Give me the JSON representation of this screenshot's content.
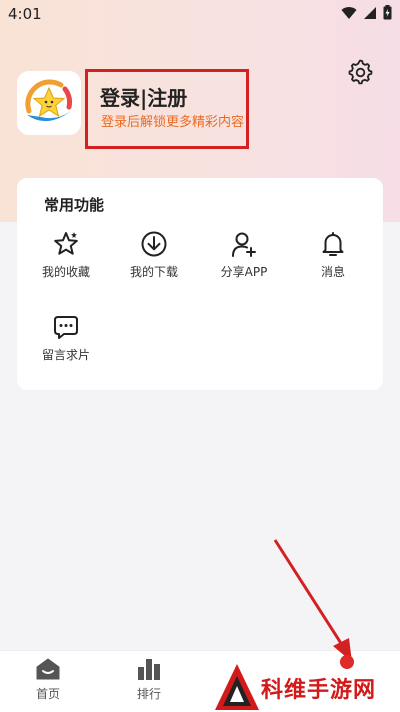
{
  "status_bar": {
    "time": "4:01"
  },
  "profile": {
    "title": "登录|注册",
    "subtitle": "登录后解锁更多精彩内容"
  },
  "functions": {
    "title": "常用功能",
    "items": [
      {
        "label": "我的收藏",
        "icon": "star-icon"
      },
      {
        "label": "我的下载",
        "icon": "download-icon"
      },
      {
        "label": "分享APP",
        "icon": "add-user-icon"
      },
      {
        "label": "消息",
        "icon": "bell-icon"
      },
      {
        "label": "留言求片",
        "icon": "message-icon"
      }
    ]
  },
  "tabbar": {
    "items": [
      {
        "label": "首页",
        "icon": "home-icon"
      },
      {
        "label": "排行",
        "icon": "chart-bars-icon"
      }
    ]
  },
  "watermark": {
    "text": "科维手游网"
  },
  "colors": {
    "highlight": "#d32020",
    "accent": "#ea6a24"
  }
}
